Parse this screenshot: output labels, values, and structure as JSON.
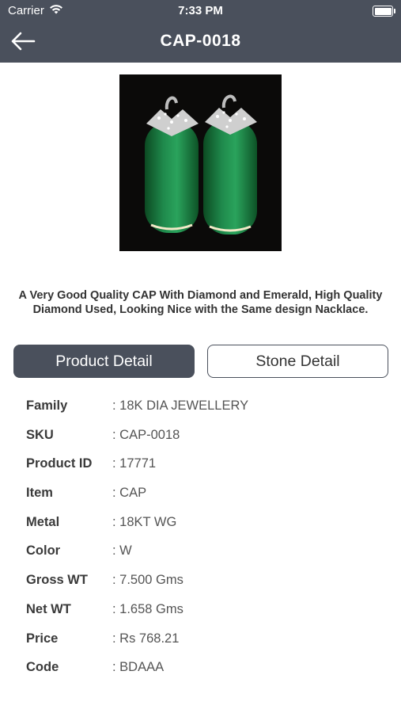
{
  "status_bar": {
    "carrier": "Carrier",
    "time": "7:33 PM"
  },
  "header": {
    "title": "CAP-0018"
  },
  "product": {
    "description": "A Very Good Quality CAP With Diamond and Emerald, High Quality Diamond Used, Looking Nice with the Same design Nacklace."
  },
  "tabs": {
    "product_detail": "Product Detail",
    "stone_detail": "Stone Detail"
  },
  "details": [
    {
      "label": "Family",
      "value": ": 18K DIA JEWELLERY"
    },
    {
      "label": "SKU",
      "value": ": CAP-0018"
    },
    {
      "label": "Product ID",
      "value": ": 17771"
    },
    {
      "label": "Item",
      "value": ": CAP"
    },
    {
      "label": "Metal",
      "value": ": 18KT WG"
    },
    {
      "label": "Color",
      "value": ": W"
    },
    {
      "label": "Gross WT",
      "value": ": 7.500 Gms"
    },
    {
      "label": "Net WT",
      "value": ": 1.658 Gms"
    },
    {
      "label": "Price",
      "value": ": Rs 768.21"
    },
    {
      "label": "Code",
      "value": ": BDAAA"
    }
  ],
  "colors": {
    "header_bg": "#4a505c",
    "active_tab_bg": "#4a505c",
    "emerald": "#1f8a4c"
  },
  "icons": {
    "back": "arrow-left-icon",
    "wifi": "wifi-icon",
    "battery": "battery-icon"
  }
}
